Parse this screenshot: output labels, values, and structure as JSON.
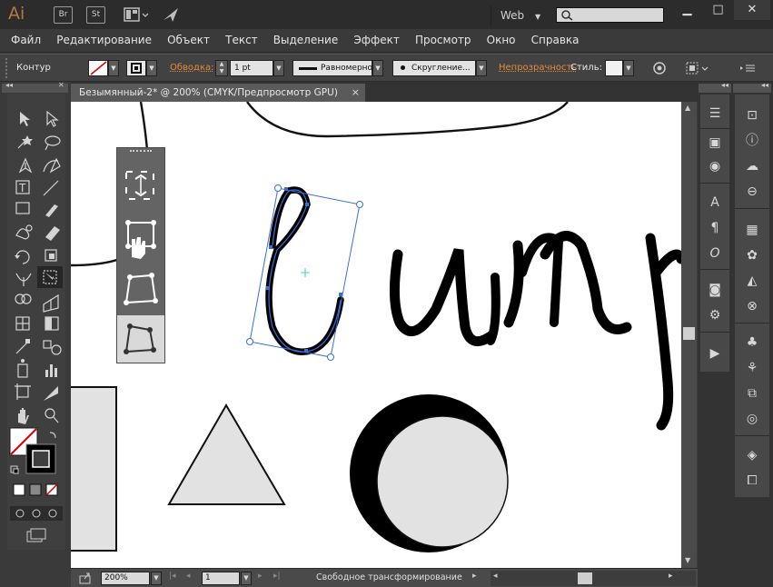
{
  "app": {
    "logo": "Ai",
    "bridge": "Br",
    "stock": "St",
    "workspace": "Web"
  },
  "menu": [
    "Файл",
    "Редактирование",
    "Объект",
    "Текст",
    "Выделение",
    "Эффект",
    "Просмотр",
    "Окно",
    "Справка"
  ],
  "control_bar": {
    "mode": "Контур",
    "stroke_label": "Обводка:",
    "stroke_weight": "1 pt",
    "profile": "Равномерно",
    "brush": "Скругление...",
    "opacity_label": "Непрозрачность",
    "style_label": "Стиль:"
  },
  "document": {
    "tab_title": "Безымянный-2* @ 200% (CMYK/Предпросмотр GPU)",
    "close": "×"
  },
  "status": {
    "zoom": "200%",
    "page": "1",
    "tool_name": "Свободное трансформирование"
  },
  "colors": {
    "accent": "#e58a3a",
    "selection": "#3a6fd8",
    "canvas": "#ffffff",
    "shape_fill": "#e2e2e2"
  }
}
